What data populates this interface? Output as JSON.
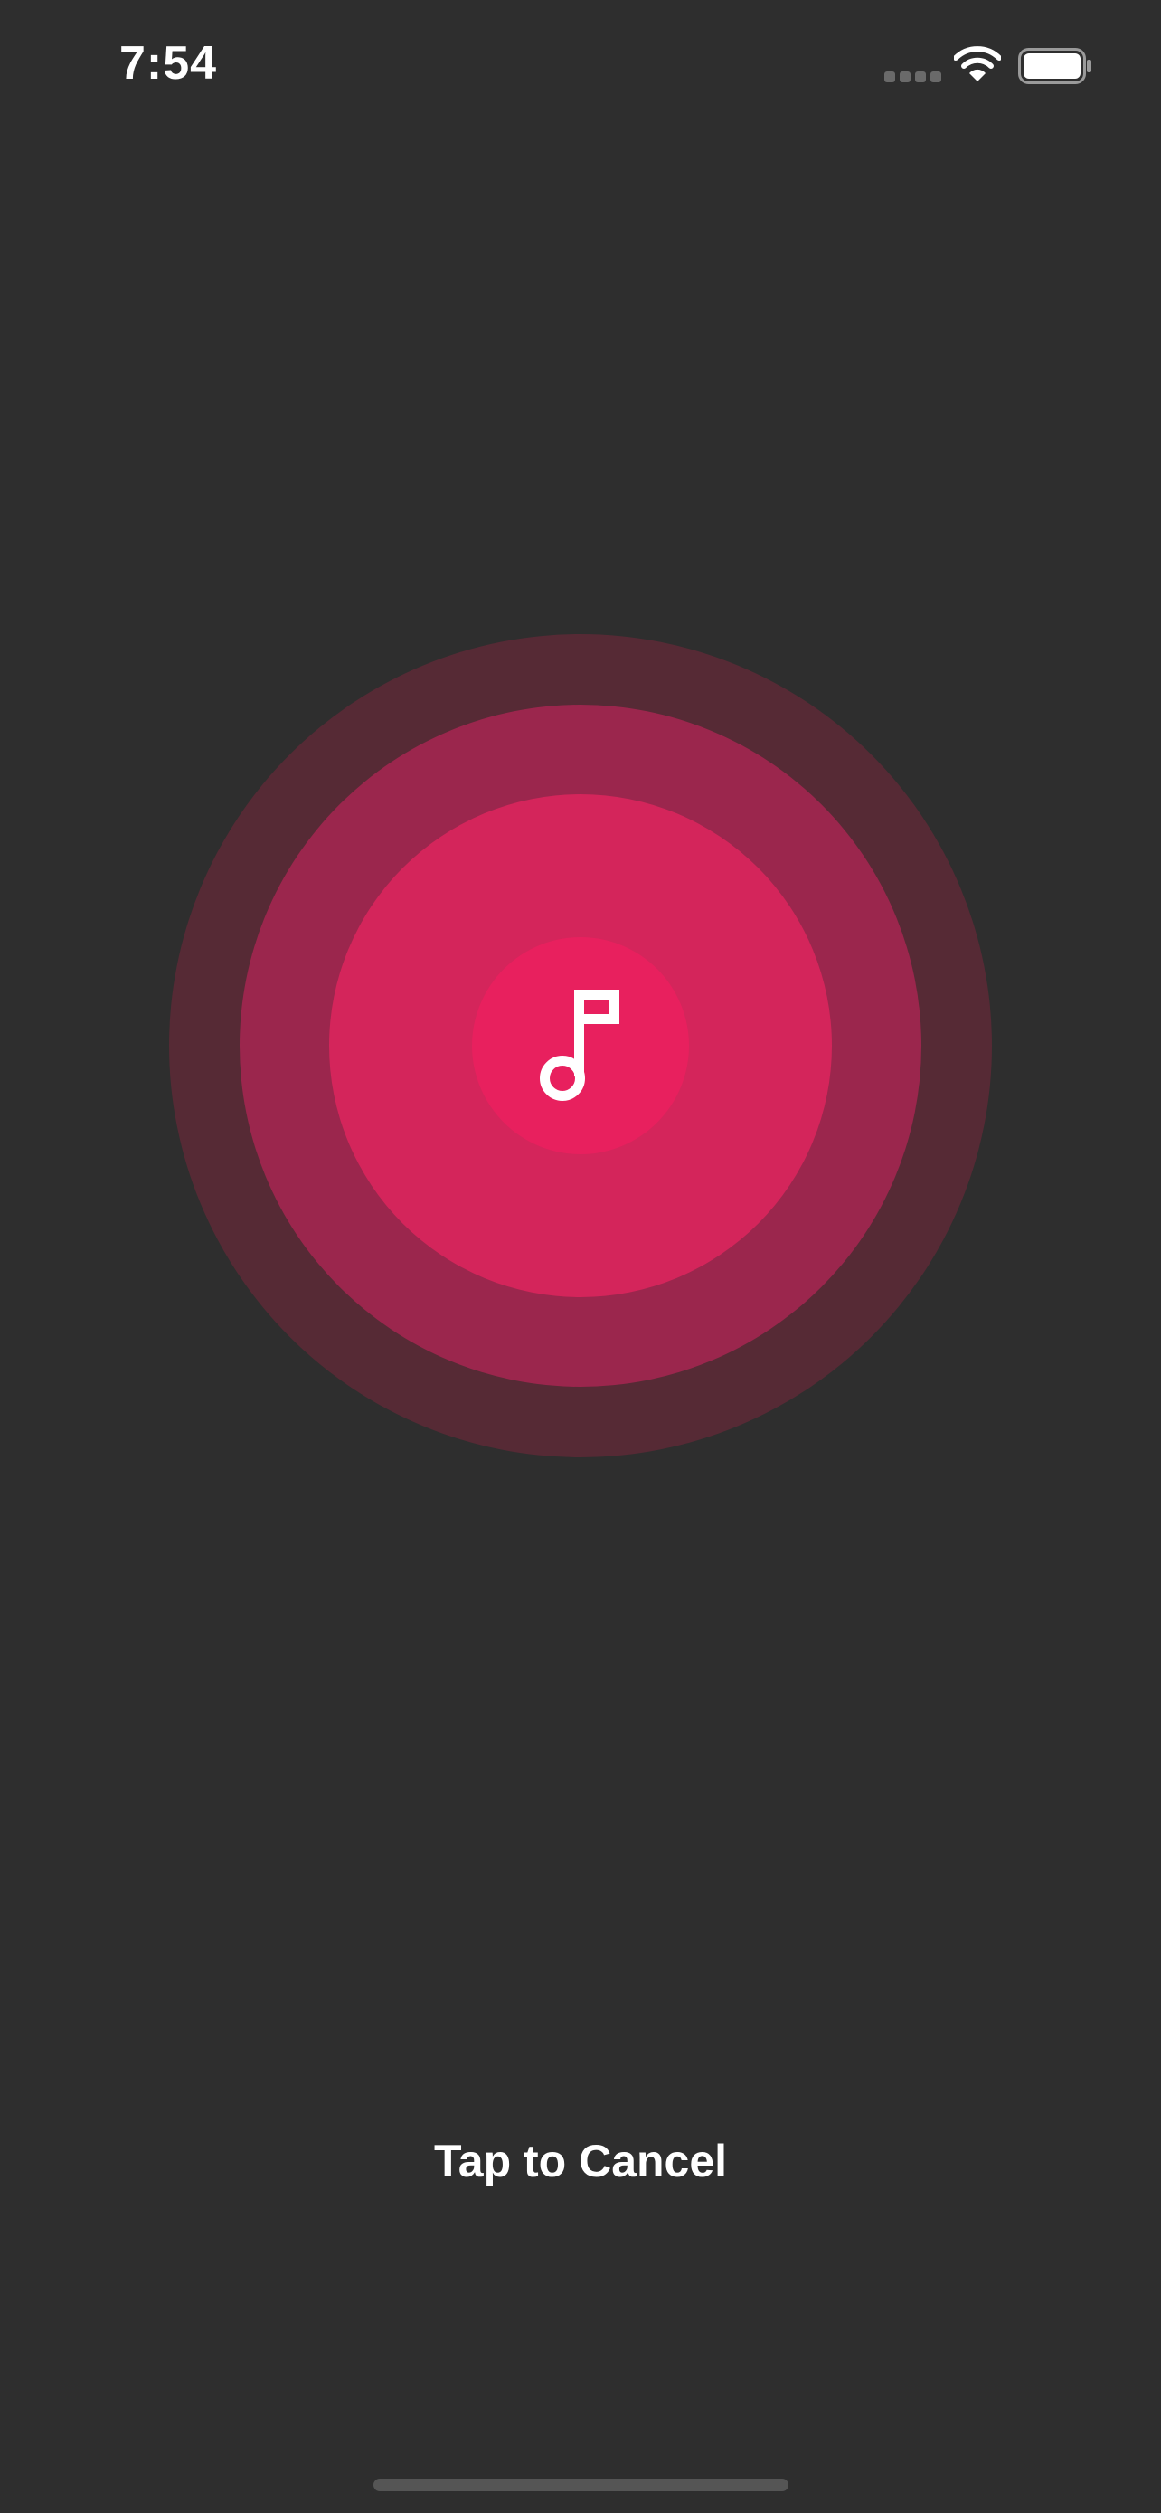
{
  "status_bar": {
    "time": "7:54",
    "signal_icon": "signal-dots-icon",
    "wifi_icon": "wifi-icon",
    "battery_icon": "battery-icon"
  },
  "recognizer": {
    "center_icon": "music-note-icon",
    "colors": {
      "outer_ring": "#562a35",
      "middle_ring": "#9b264d",
      "inner_ring": "#d4255b",
      "core": "#e8205e"
    }
  },
  "cancel": {
    "label": "Tap to Cancel"
  },
  "colors": {
    "background": "#2e2e2e",
    "text": "#ffffff"
  }
}
